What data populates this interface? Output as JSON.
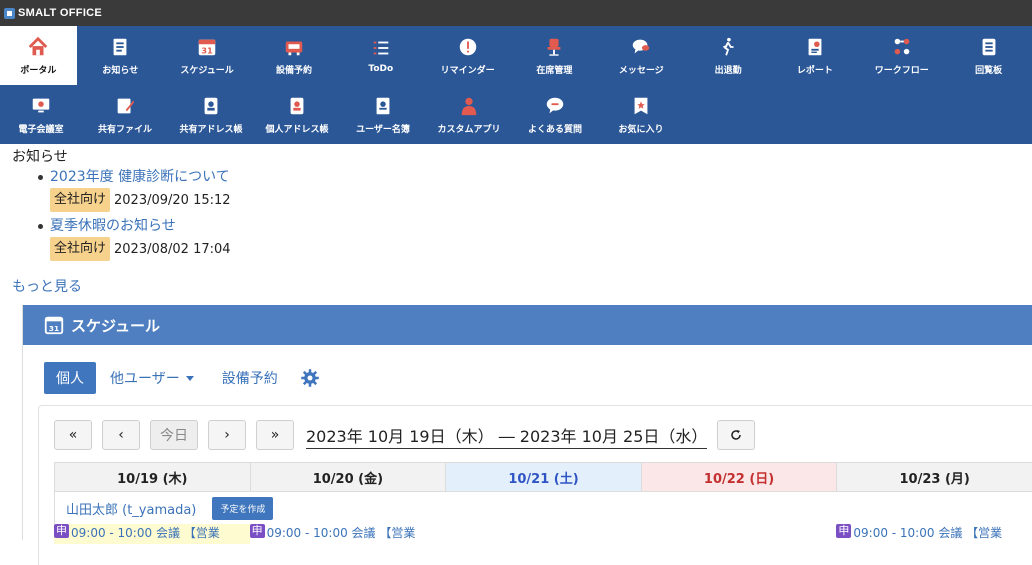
{
  "app": {
    "title": "SMALT OFFICE"
  },
  "nav_row1": [
    {
      "label": "ポータル",
      "icon": "home-icon"
    },
    {
      "label": "お知らせ",
      "icon": "notice-icon"
    },
    {
      "label": "スケジュール",
      "icon": "calendar-icon"
    },
    {
      "label": "設備予約",
      "icon": "facility-icon"
    },
    {
      "label": "ToDo",
      "icon": "todo-icon"
    },
    {
      "label": "リマインダー",
      "icon": "reminder-icon"
    },
    {
      "label": "在席管理",
      "icon": "chair-icon"
    },
    {
      "label": "メッセージ",
      "icon": "message-icon"
    },
    {
      "label": "出退勤",
      "icon": "walk-icon"
    },
    {
      "label": "レポート",
      "icon": "report-icon"
    },
    {
      "label": "ワークフロー",
      "icon": "workflow-icon"
    },
    {
      "label": "回覧板",
      "icon": "circular-icon"
    }
  ],
  "nav_row2": [
    {
      "label": "電子会議室",
      "icon": "monitor-icon"
    },
    {
      "label": "共有ファイル",
      "icon": "shared-file-icon"
    },
    {
      "label": "共有アドレス帳",
      "icon": "shared-address-icon"
    },
    {
      "label": "個人アドレス帳",
      "icon": "personal-address-icon"
    },
    {
      "label": "ユーザー名簿",
      "icon": "user-list-icon"
    },
    {
      "label": "カスタムアプリ",
      "icon": "custom-app-icon"
    },
    {
      "label": "よくある質問",
      "icon": "faq-icon"
    },
    {
      "label": "お気に入り",
      "icon": "favorite-icon"
    }
  ],
  "news": {
    "title": "お知らせ",
    "items": [
      {
        "title": "2023年度 健康診断について",
        "badge": "全社向け",
        "date": "2023/09/20 15:12"
      },
      {
        "title": "夏季休暇のお知らせ",
        "badge": "全社向け",
        "date": "2023/08/02 17:04"
      }
    ],
    "more": "もっと見る"
  },
  "schedule": {
    "title": "スケジュール",
    "tab_personal": "個人",
    "tab_other_users": "他ユーザー",
    "tab_facility": "設備予約",
    "btn_first": "«",
    "btn_prev": "‹",
    "btn_today": "今日",
    "btn_next": "›",
    "btn_last": "»",
    "range": "2023年 10月 19日（木） ― 2023年 10月 25日（水）",
    "days": [
      "10/19 (木)",
      "10/20 (金)",
      "10/21 (土)",
      "10/22 (日)",
      "10/23 (月)"
    ],
    "user_name": "山田太郎 (t_yamada)",
    "create_label": "予定を作成",
    "event_tag": "申",
    "event_text": "09:00 - 10:00 会議 【営業"
  },
  "colors": {
    "nav_bg": "#2b5797",
    "accent": "#3f76bd",
    "badge": "#f6d28c",
    "panel_header": "#4f7fc1"
  }
}
